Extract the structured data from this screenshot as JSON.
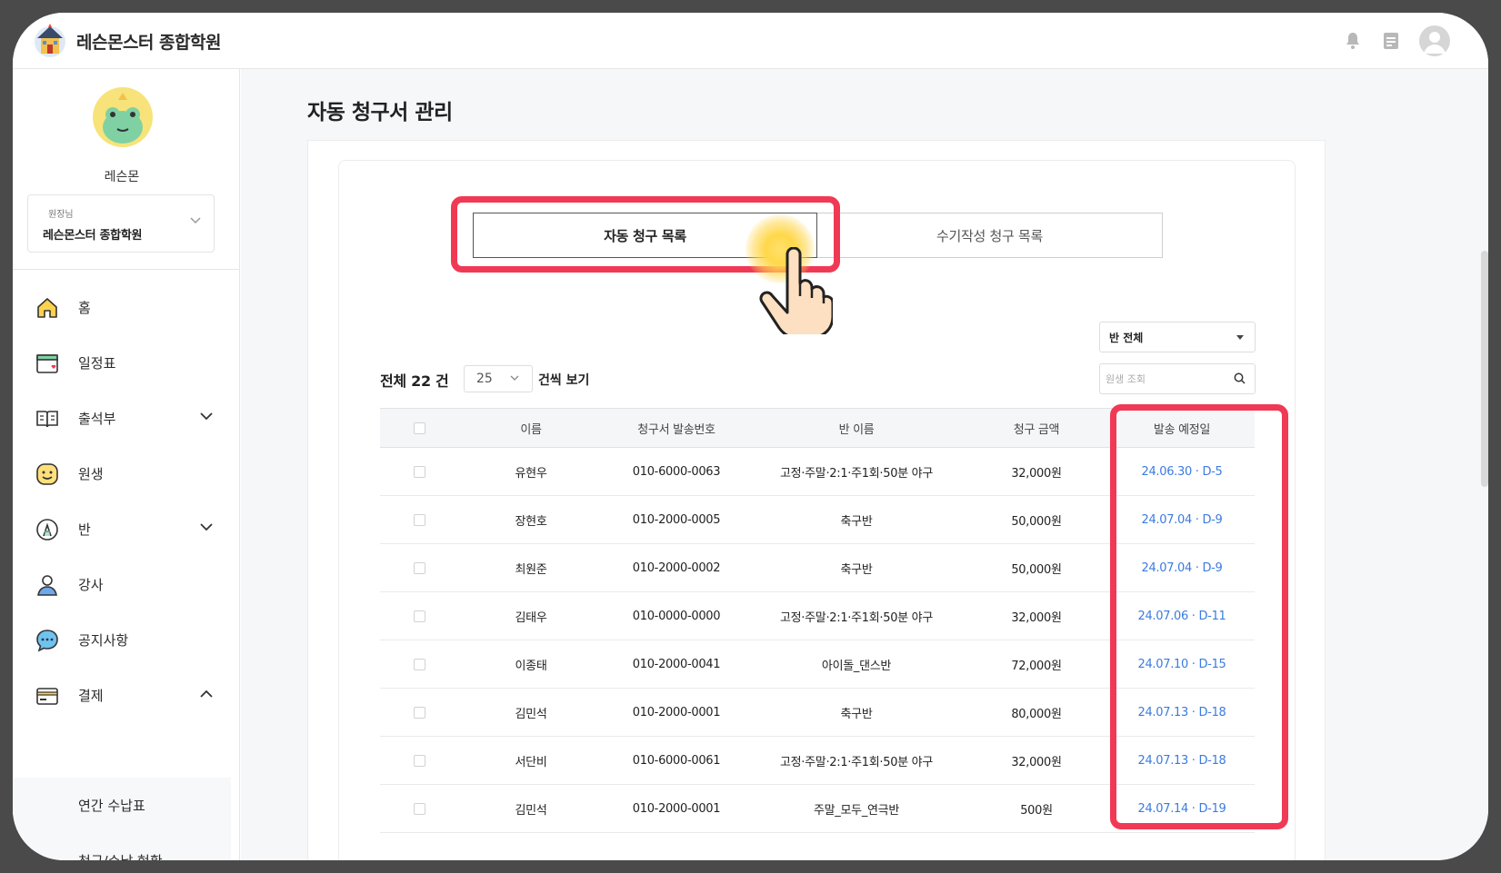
{
  "app": {
    "title": "레슨몬스터 종합학원"
  },
  "sidebar": {
    "profile_name": "레슨몬",
    "org_role": "원장님",
    "org_name": "레슨몬스터 종합학원",
    "menu": [
      {
        "label": "홈",
        "icon": "home-icon"
      },
      {
        "label": "일정표",
        "icon": "calendar-icon"
      },
      {
        "label": "출석부",
        "icon": "book-icon",
        "expandable": true
      },
      {
        "label": "원생",
        "icon": "smile-icon"
      },
      {
        "label": "반",
        "icon": "class-icon",
        "expandable": true
      },
      {
        "label": "강사",
        "icon": "person-icon"
      },
      {
        "label": "공지사항",
        "icon": "chat-icon"
      },
      {
        "label": "결제",
        "icon": "card-icon",
        "expanded": true
      }
    ],
    "submenu": [
      "연간 수납표",
      "청구/수납 현황"
    ]
  },
  "page": {
    "title": "자동 청구서 관리"
  },
  "tabs": {
    "active": "자동 청구 목록",
    "inactive": "수기작성 청구 목록"
  },
  "list": {
    "total_label": "전체 22 건",
    "page_size": "25",
    "per_label": "건씩 보기",
    "class_filter": "반 전체",
    "search_placeholder": "원생 조회"
  },
  "table": {
    "headers": {
      "name": "이름",
      "invoice_no": "청구서 발송번호",
      "class": "반 이름",
      "amount": "청구 금액",
      "send_date": "발송 예정일"
    },
    "rows": [
      {
        "name": "유현우",
        "invoice_no": "010-6000-0063",
        "class": "고정·주말·2:1·주1회·50분 야구",
        "amount": "32,000원",
        "send_date": "24.06.30 · D-5"
      },
      {
        "name": "장현호",
        "invoice_no": "010-2000-0005",
        "class": "축구반",
        "amount": "50,000원",
        "send_date": "24.07.04 · D-9"
      },
      {
        "name": "최원준",
        "invoice_no": "010-2000-0002",
        "class": "축구반",
        "amount": "50,000원",
        "send_date": "24.07.04 · D-9"
      },
      {
        "name": "김태우",
        "invoice_no": "010-0000-0000",
        "class": "고정·주말·2:1·주1회·50분 야구",
        "amount": "32,000원",
        "send_date": "24.07.06 · D-11"
      },
      {
        "name": "이종태",
        "invoice_no": "010-2000-0041",
        "class": "아이돌_댄스반",
        "amount": "72,000원",
        "send_date": "24.07.10 · D-15"
      },
      {
        "name": "김민석",
        "invoice_no": "010-2000-0001",
        "class": "축구반",
        "amount": "80,000원",
        "send_date": "24.07.13 · D-18"
      },
      {
        "name": "서단비",
        "invoice_no": "010-6000-0061",
        "class": "고정·주말·2:1·주1회·50분 야구",
        "amount": "32,000원",
        "send_date": "24.07.13 · D-18"
      },
      {
        "name": "김민석",
        "invoice_no": "010-2000-0001",
        "class": "주말_모두_연극반",
        "amount": "500원",
        "send_date": "24.07.14 · D-19"
      }
    ]
  },
  "colors": {
    "highlight": "#f03a55",
    "date_link": "#3b7be0",
    "avatar_bg": "#f7e37a"
  }
}
